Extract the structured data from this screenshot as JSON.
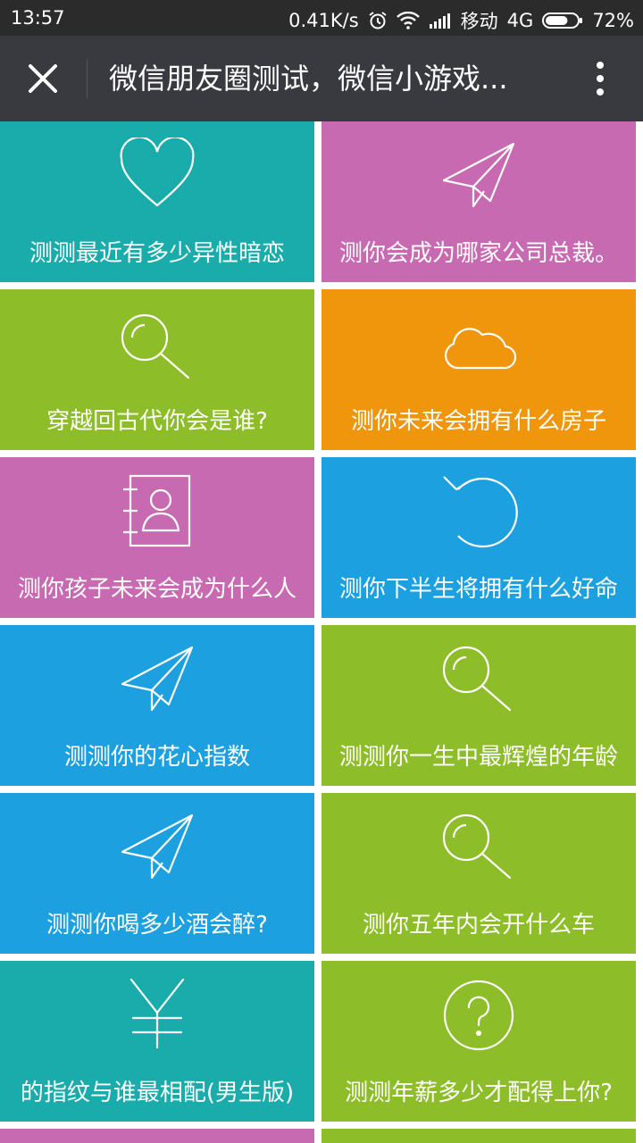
{
  "status_bar": {
    "time": "13:57",
    "net_speed": "0.41K/s",
    "carrier": "移动",
    "network": "4G",
    "battery": "72%",
    "battery_level": 0.72
  },
  "title_bar": {
    "title": "微信朋友圈测试，微信小游戏..."
  },
  "colors": {
    "teal": "#1aabab",
    "pink": "#c86ab1",
    "green": "#8dbd28",
    "orange": "#f0960c",
    "blue": "#1da0e0",
    "title_bar": "#393a3f",
    "status_bar": "#2b2b2b"
  },
  "tiles": [
    {
      "label": "测测最近有多少异性暗恋",
      "icon": "heart-icon",
      "color": "teal"
    },
    {
      "label": "测你会成为哪家公司总裁。",
      "icon": "paper-plane-icon",
      "color": "pink"
    },
    {
      "label": "穿越回古代你会是谁?",
      "icon": "search-icon",
      "color": "green"
    },
    {
      "label": "测你未来会拥有什么房子",
      "icon": "cloud-icon",
      "color": "orange"
    },
    {
      "label": "测你孩子未来会成为什么人",
      "icon": "contact-book-icon",
      "color": "pink"
    },
    {
      "label": "测你下半生将拥有什么好命",
      "icon": "refresh-icon",
      "color": "blue"
    },
    {
      "label": "测测你的花心指数",
      "icon": "paper-plane-icon",
      "color": "blue"
    },
    {
      "label": "测测你一生中最辉煌的年龄",
      "icon": "search-icon",
      "color": "green"
    },
    {
      "label": "测测你喝多少酒会醉?",
      "icon": "paper-plane-icon",
      "color": "blue"
    },
    {
      "label": "测你五年内会开什么车",
      "icon": "search-icon",
      "color": "green"
    },
    {
      "label": "的指纹与谁最相配(男生版)",
      "icon": "yen-icon",
      "color": "teal"
    },
    {
      "label": "测测年薪多少才配得上你?",
      "icon": "question-icon",
      "color": "green"
    }
  ]
}
